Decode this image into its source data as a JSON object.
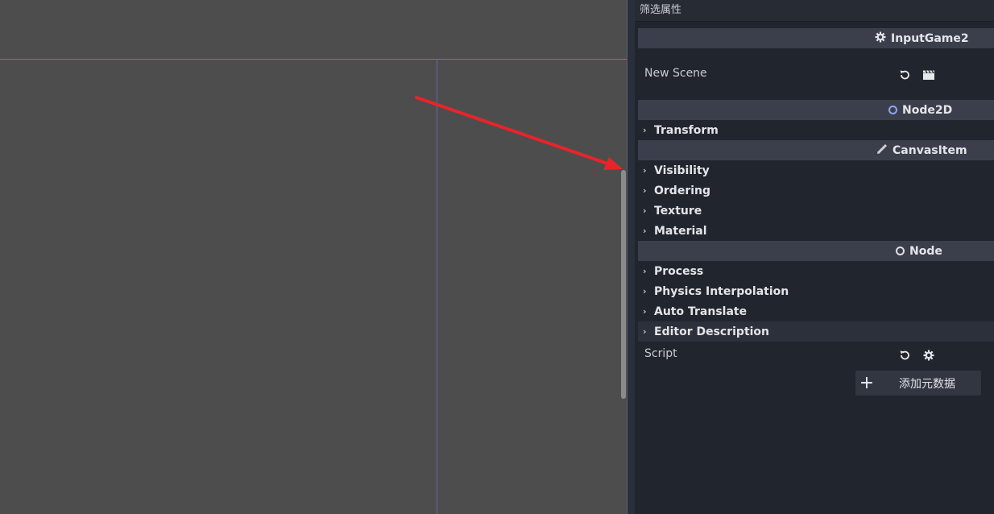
{
  "inspector": {
    "filter_label": "筛选属性",
    "header_input_game": "InputGame2",
    "new_scene_label": "New Scene",
    "header_node2d": "Node2D",
    "transform": "Transform",
    "header_canvasitem": "CanvasItem",
    "visibility": "Visibility",
    "ordering": "Ordering",
    "texture": "Texture",
    "material": "Material",
    "header_node": "Node",
    "process": "Process",
    "physics_interpolation": "Physics Interpolation",
    "auto_translate": "Auto Translate",
    "editor_description": "Editor Description",
    "script_label": "Script",
    "add_metadata": "添加元数据"
  },
  "icons": {
    "script_gear": "gear-script-icon",
    "revert": "revert-icon",
    "scene": "clapperboard-icon",
    "node2d": "node2d-circle-icon",
    "canvasitem": "pencil-icon",
    "node": "node-circle-icon",
    "add": "plus-icon"
  },
  "colors": {
    "viewport_bg": "#4d4d4d",
    "inspector_bg": "#21252e",
    "section_header_bg": "#3a3f4b",
    "x_axis_line": "#d64c7e",
    "y_axis_line": "#6b63a8",
    "annotation_arrow": "#e8242a"
  }
}
